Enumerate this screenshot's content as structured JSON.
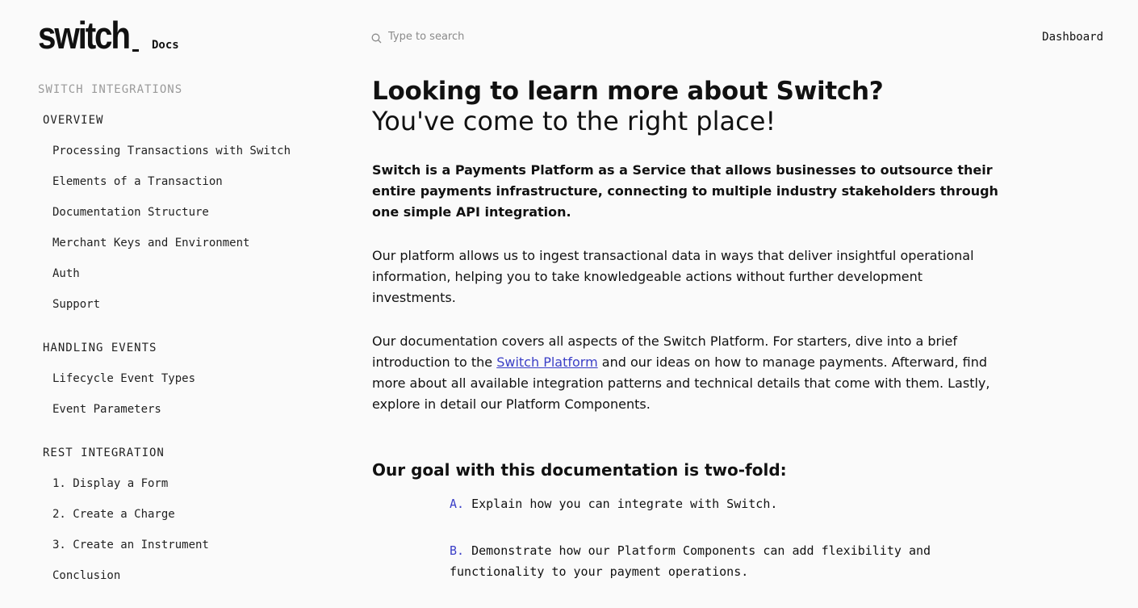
{
  "header": {
    "logo_text": "switch",
    "docs_label": "Docs",
    "search_placeholder": "Type to search",
    "dashboard_label": "Dashboard"
  },
  "sidebar": {
    "title": "SWITCH INTEGRATIONS",
    "sections": [
      {
        "header": "OVERVIEW",
        "items": [
          "Processing Transactions with Switch",
          "Elements of a Transaction",
          "Documentation Structure",
          "Merchant Keys and Environment",
          "Auth",
          "Support"
        ]
      },
      {
        "header": "HANDLING EVENTS",
        "items": [
          "Lifecycle Event Types",
          "Event Parameters"
        ]
      },
      {
        "header": "REST INTEGRATION",
        "items": [
          "1. Display a Form",
          "2. Create a Charge",
          "3. Create an Instrument",
          "Conclusion"
        ]
      }
    ]
  },
  "main": {
    "title": "Looking to learn more about Switch?",
    "subtitle": "You've come to the right place!",
    "intro": "Switch is a Payments Platform as a Service that allows businesses to outsource their entire payments infrastructure, connecting to multiple industry stakeholders through one simple API integration.",
    "para1": "Our platform allows us to ingest transactional data in ways that deliver insightful operational information, helping you to take knowledgeable actions without further development investments.",
    "para2_before": "Our documentation covers all aspects of the Switch Platform. For starters, dive into a brief introduction to the ",
    "para2_link": "Switch Platform",
    "para2_after": " and our ideas on how to manage payments. Afterward, find more about all available integration patterns and technical details that come with them. Lastly, explore in detail our Platform Components.",
    "goal_heading": "Our goal with this documentation is two-fold:",
    "goals": [
      {
        "letter": "A.",
        "text": "Explain how you can integrate with Switch."
      },
      {
        "letter": "B.",
        "text": "Demonstrate how our Platform Components can add flexibility and functionality to your payment operations."
      }
    ]
  },
  "colors": {
    "background": "#fafafa",
    "accent": "#3b3fc7",
    "muted": "#9a9a9a"
  }
}
